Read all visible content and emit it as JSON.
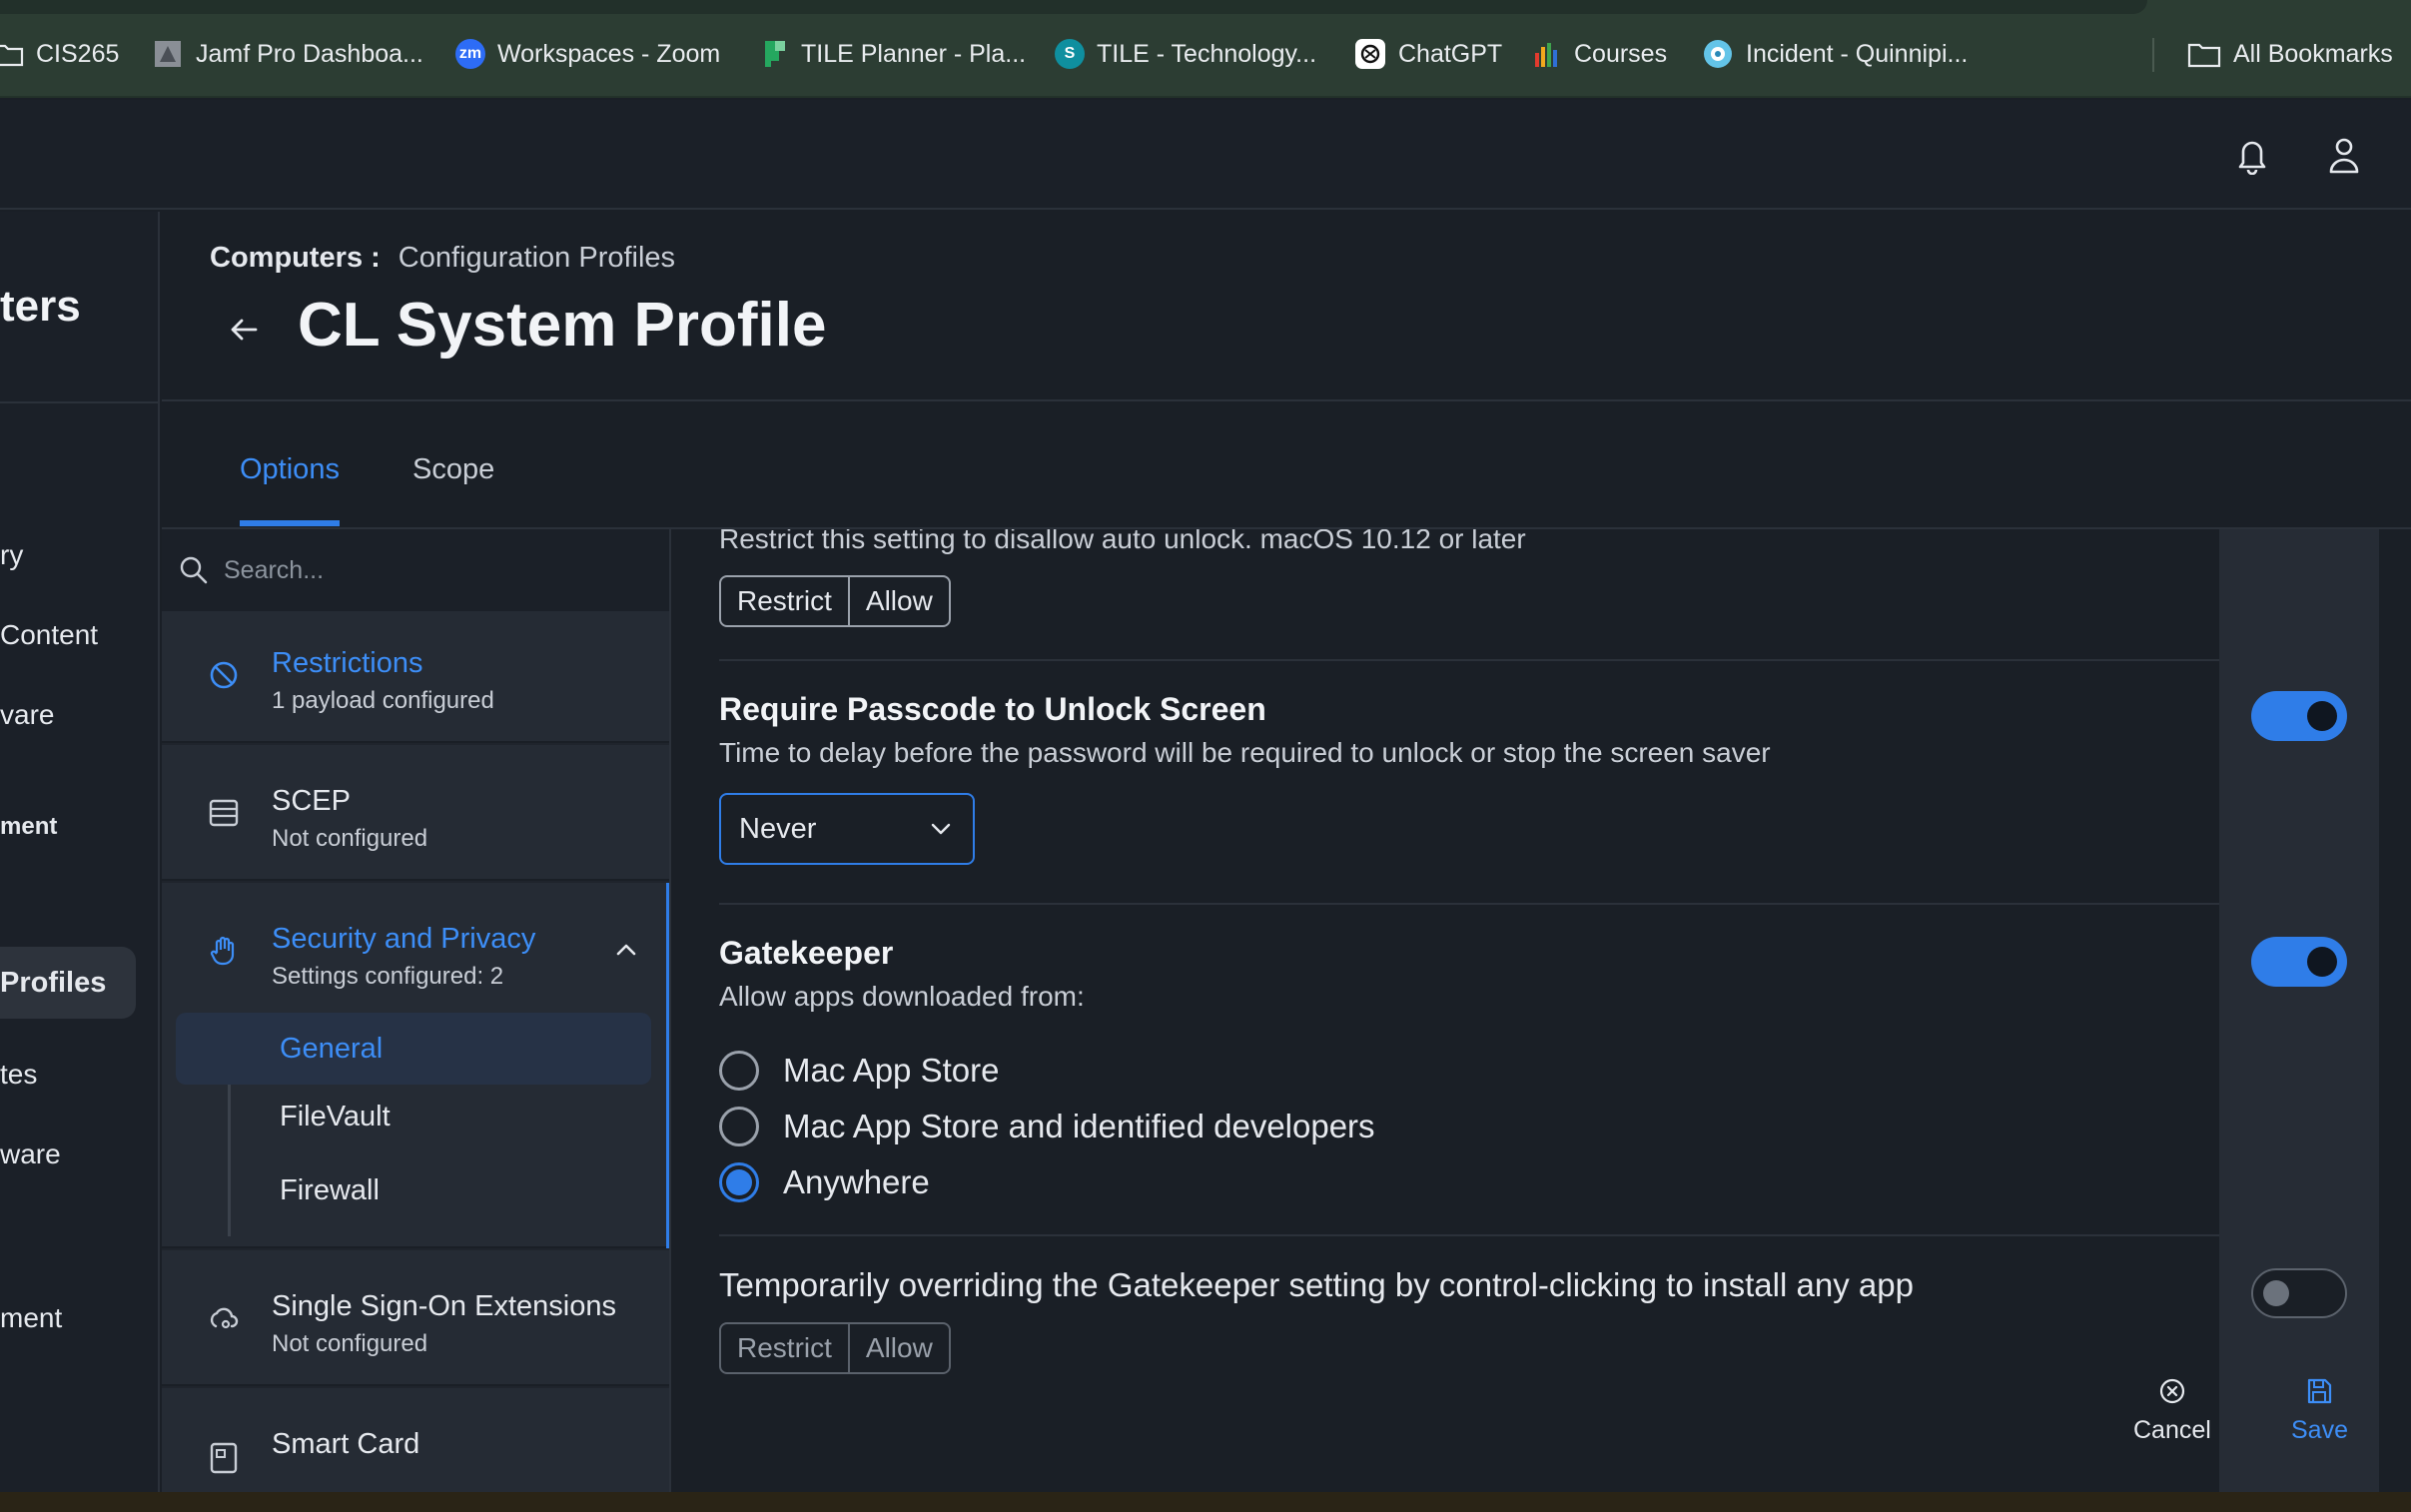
{
  "bookmarks": [
    {
      "label": "CIS265",
      "icon": "folder-icon"
    },
    {
      "label": "Jamf Pro Dashboa...",
      "icon": "jamf-icon"
    },
    {
      "label": "Workspaces - Zoom",
      "icon": "zoom-icon",
      "glyph": "zm"
    },
    {
      "label": "TILE Planner - Pla...",
      "icon": "planner-icon"
    },
    {
      "label": "TILE - Technology...",
      "icon": "sharepoint-icon",
      "glyph": "S"
    },
    {
      "label": "ChatGPT",
      "icon": "chatgpt-icon"
    },
    {
      "label": "Courses",
      "icon": "courses-icon"
    },
    {
      "label": "Incident - Quinnipi...",
      "icon": "incident-icon"
    },
    {
      "label": "All Bookmarks",
      "icon": "folder-icon"
    }
  ],
  "left_nav": {
    "title": "ters",
    "items": [
      "ry",
      " Content",
      "vare",
      "ment",
      "Profiles",
      "tes",
      "ware",
      "ment"
    ]
  },
  "header": {
    "breadcrumb_parent": "Computers :",
    "breadcrumb_current": "Configuration Profiles",
    "title": "CL System Profile"
  },
  "tabs": [
    "Options",
    "Scope"
  ],
  "search": {
    "placeholder": "Search..."
  },
  "payloads": {
    "restrictions": {
      "name": "Restrictions",
      "sub": "1 payload configured"
    },
    "scep": {
      "name": "SCEP",
      "sub": "Not configured"
    },
    "security": {
      "name": "Security and Privacy",
      "sub": "Settings configured: 2",
      "children": [
        "General",
        "FileVault",
        "Firewall"
      ]
    },
    "sso": {
      "name": "Single Sign-On Extensions",
      "sub": "Not configured"
    },
    "smartcard": {
      "name": "Smart Card"
    }
  },
  "settings": {
    "auto_unlock": {
      "description": "Restrict this setting to disallow auto unlock. macOS 10.12 or later",
      "options": [
        "Restrict",
        "Allow"
      ]
    },
    "passcode": {
      "title": "Require Passcode to Unlock Screen",
      "description": "Time to delay before the password will be required to unlock or stop the screen saver",
      "value": "Never",
      "enabled": true
    },
    "gatekeeper": {
      "title": "Gatekeeper",
      "description": "Allow apps downloaded from:",
      "options": [
        "Mac App Store",
        "Mac App Store and identified developers",
        "Anywhere"
      ],
      "selected": "Anywhere",
      "enabled": true
    },
    "override": {
      "title": "Temporarily overriding the Gatekeeper setting by control-clicking to install any app",
      "options": [
        "Restrict",
        "Allow"
      ],
      "enabled": false
    }
  },
  "actions": {
    "cancel": "Cancel",
    "save": "Save"
  },
  "colors": {
    "accent": "#2f7de8",
    "background": "#1a1f26",
    "bookmarks_bar": "#2c3d33"
  }
}
